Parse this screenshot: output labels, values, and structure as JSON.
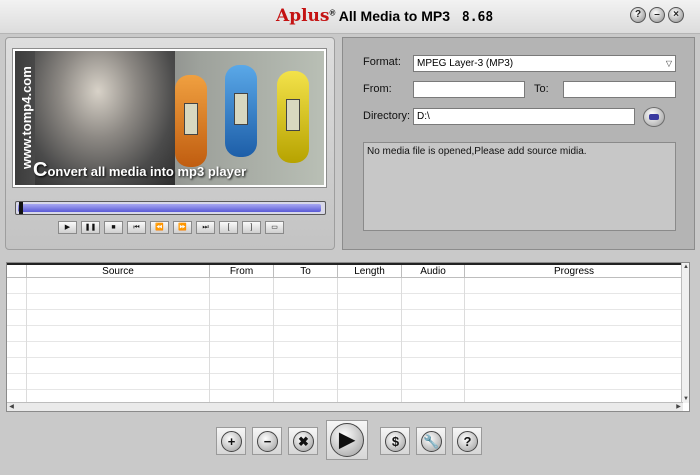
{
  "window": {
    "title_brand": "Aplus",
    "title_mark": "®",
    "title_text": "All Media to MP3",
    "version": "8.68",
    "buttons": {
      "help": "?",
      "minimize": "–",
      "close": "×"
    }
  },
  "preview": {
    "watermark": "www.tomp4.com",
    "slogan_initial": "C",
    "slogan_rest": "onvert all media into mp3 player",
    "controls": [
      "▶",
      "❚❚",
      "■",
      "⏮",
      "⏪",
      "⏩",
      "⏭",
      "[",
      "]",
      "▭"
    ]
  },
  "settings": {
    "format_label": "Format:",
    "format_value": "MPEG Layer-3 (MP3)",
    "from_label": "From:",
    "from_value": "",
    "to_label": "To:",
    "to_value": "",
    "directory_label": "Directory:",
    "directory_value": "D:\\",
    "message": "No media file is opened,Please add source midia."
  },
  "table": {
    "columns": [
      "Source",
      "From",
      "To",
      "Length",
      "Audio",
      "Progress"
    ]
  },
  "toolbar": {
    "add": "+",
    "remove": "−",
    "clear": "✖",
    "start": "▶",
    "buy": "$",
    "options": "🔧",
    "help": "?"
  },
  "colors": {
    "brand_red": "#c41212",
    "progress_fill": "#6a6ae0",
    "panel_gray": "#b4b4b4"
  }
}
